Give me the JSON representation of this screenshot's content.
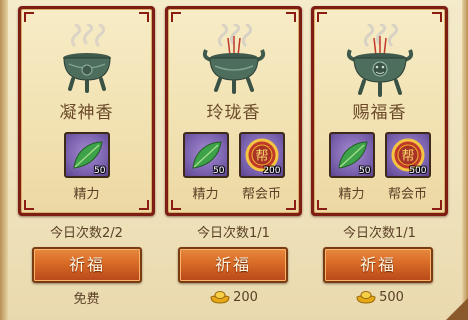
{
  "cards": [
    {
      "title": "凝神香",
      "items": [
        {
          "icon": "leaf-icon",
          "count": "50",
          "name": "精力"
        }
      ],
      "times_label": "今日次数2/2",
      "button_label": "祈福",
      "cost_text": "免费",
      "cost_icon": ""
    },
    {
      "title": "玲珑香",
      "items": [
        {
          "icon": "leaf-icon",
          "count": "50",
          "name": "精力"
        },
        {
          "icon": "guild-coin-icon",
          "coin_glyph": "帮",
          "count": "200",
          "name": "帮会币"
        }
      ],
      "times_label": "今日次数1/1",
      "button_label": "祈福",
      "cost_text": "200",
      "cost_icon": "gold-ingot-icon"
    },
    {
      "title": "赐福香",
      "items": [
        {
          "icon": "leaf-icon",
          "count": "50",
          "name": "精力"
        },
        {
          "icon": "guild-coin-icon",
          "coin_glyph": "帮",
          "count": "500",
          "name": "帮会币"
        }
      ],
      "times_label": "今日次数1/1",
      "button_label": "祈福",
      "cost_text": "500",
      "cost_icon": "gold-ingot-icon"
    }
  ],
  "colors": {
    "card_border": "#7d1d14",
    "button": "#d86a26",
    "item_bg": "#7d64b0"
  }
}
